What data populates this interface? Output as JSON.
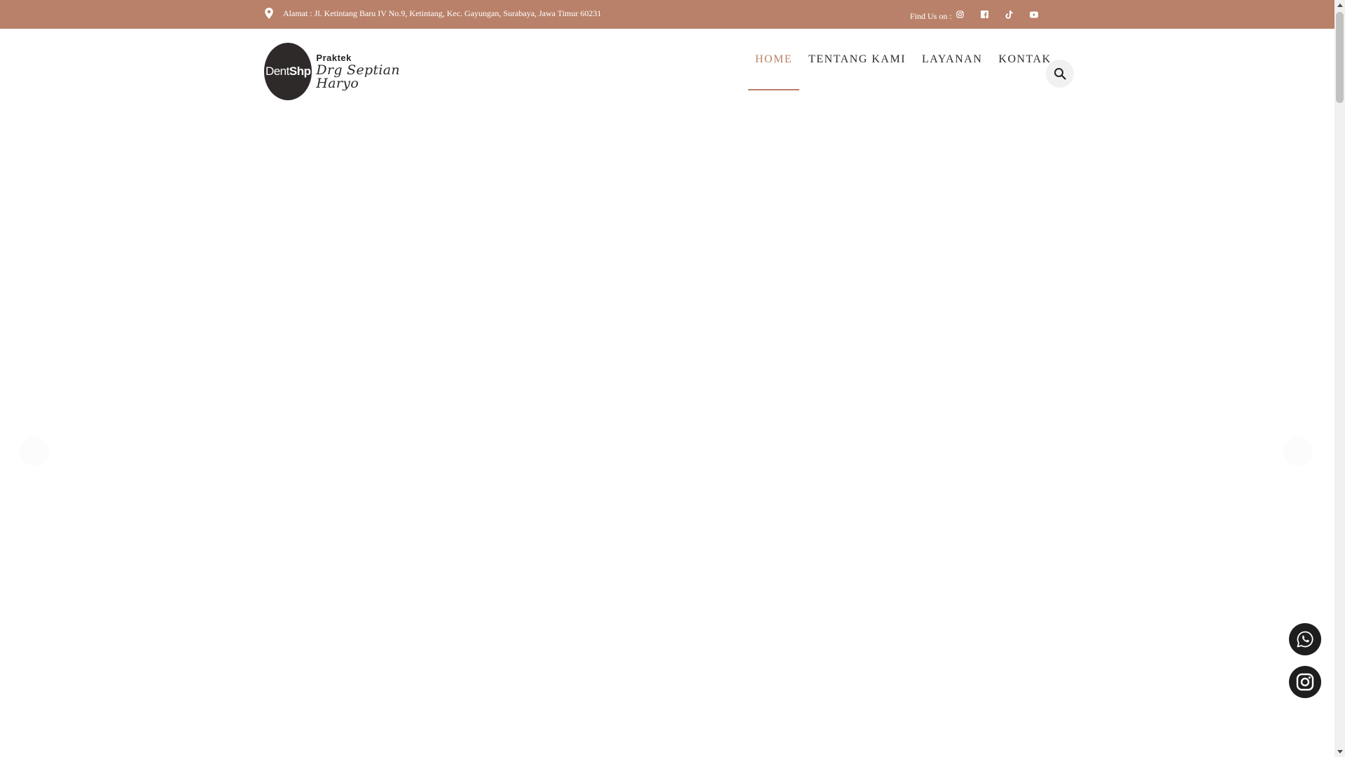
{
  "topbar": {
    "address": "Alamat : Jl. Ketintang Baru IV No.9, Ketintang, Kec. Gayungan, Surabaya, Jawa Timur 60231",
    "find_us": "Find Us on :",
    "social_icons": [
      "instagram-icon",
      "facebook-icon",
      "tiktok-icon",
      "youtube-icon"
    ]
  },
  "logo": {
    "brand_light": "Dent",
    "brand_bold": "Shp",
    "praktek": "Praktek",
    "signature": "Drg Septian Haryo"
  },
  "nav": {
    "items": [
      {
        "label": "HOME",
        "active": true
      },
      {
        "label": "TENTANG KAMI",
        "active": false
      },
      {
        "label": "LAYANAN",
        "active": false
      },
      {
        "label": "KONTAK",
        "active": false
      }
    ]
  },
  "colors": {
    "accent": "#b98169",
    "dark": "#1e1e1e",
    "search_bg": "#f1f1f1"
  }
}
